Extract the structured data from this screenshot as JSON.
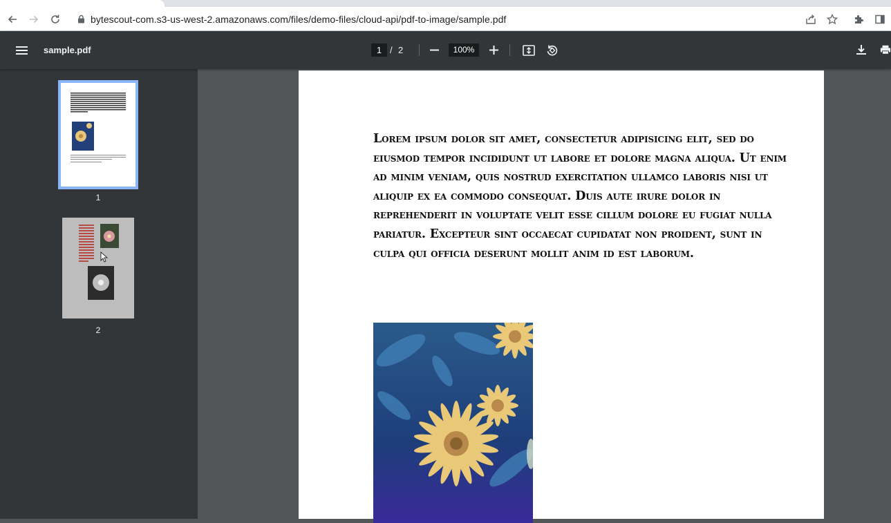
{
  "browser": {
    "url": "bytescout-com.s3-us-west-2.amazonaws.com/files/demo-files/cloud-api/pdf-to-image/sample.pdf",
    "icons": [
      "back-arrow-icon",
      "forward-arrow-icon",
      "reload-icon",
      "lock-icon",
      "share-icon",
      "star-icon",
      "puzzle-icon",
      "side-panel-icon"
    ]
  },
  "pdf_toolbar": {
    "title": "sample.pdf",
    "current_page": "1",
    "page_separator": "/",
    "total_pages": "2",
    "zoom": "100%",
    "icons": [
      "menu-icon",
      "zoom-out-icon",
      "zoom-in-icon",
      "fit-page-icon",
      "rotate-icon",
      "download-icon",
      "print-icon"
    ]
  },
  "sidebar": {
    "thumbnails": [
      {
        "label": "1",
        "selected": true
      },
      {
        "label": "2",
        "selected": false
      }
    ]
  },
  "document": {
    "paragraph": "Lorem ipsum dolor sit amet, consectetur adipisicing elit, sed do eiusmod tempor incididunt ut labore et dolore magna aliqua. Ut enim ad minim veniam, quis nostrud exercitation ullamco laboris nisi ut aliquip ex ea commodo consequat. Duis aute irure dolor in reprehenderit in voluptate velit esse cillum dolore eu fugiat nulla pariatur. Excepteur sint occaecat cupidatat non proident, sunt in culpa qui officia deserunt mollit anim id est laborum."
  },
  "colors": {
    "toolbar": "#323639",
    "viewer_bg": "#525659",
    "thumb_selected_border": "#8ab4f8"
  }
}
